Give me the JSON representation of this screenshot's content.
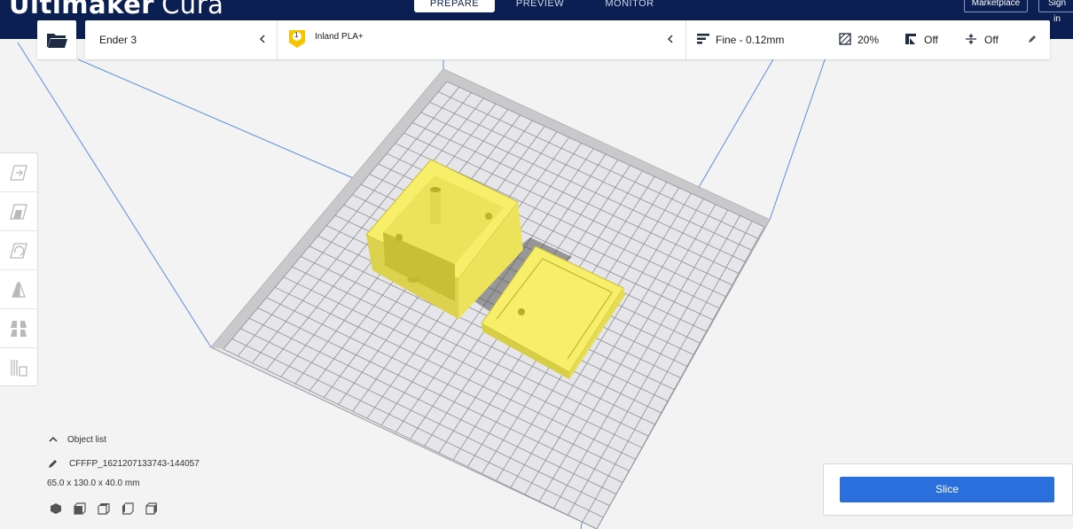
{
  "app": {
    "brand_bold": "Ultimaker",
    "brand_light": "Cura"
  },
  "stages": [
    {
      "label": "PREPARE",
      "active": true
    },
    {
      "label": "PREVIEW",
      "active": false
    },
    {
      "label": "MONITOR",
      "active": false
    }
  ],
  "header_buttons": {
    "marketplace": "Marketplace",
    "sign_in": "Sign in"
  },
  "printer": {
    "name": "Ender 3"
  },
  "material": {
    "extruder_number": "1",
    "name": "Inland PLA+",
    "badge_color": "#f7c400"
  },
  "settings": {
    "profile": "Fine - 0.12mm",
    "infill": "20%",
    "support": "Off",
    "adhesion": "Off"
  },
  "tools": [
    {
      "name": "move-tool-icon"
    },
    {
      "name": "scale-tool-icon"
    },
    {
      "name": "rotate-tool-icon"
    },
    {
      "name": "mirror-tool-icon"
    },
    {
      "name": "per-model-settings-icon"
    },
    {
      "name": "support-blocker-icon"
    }
  ],
  "object_panel": {
    "list_label": "Object list",
    "object_name": "CFFFP_1621207133743-144057",
    "dimensions": "65.0 x 130.0 x 40.0 mm"
  },
  "slice": {
    "button_label": "Slice"
  },
  "colors": {
    "header": "#0b1f52",
    "accent": "#2a6fdb",
    "model": "#f7ee6a"
  }
}
